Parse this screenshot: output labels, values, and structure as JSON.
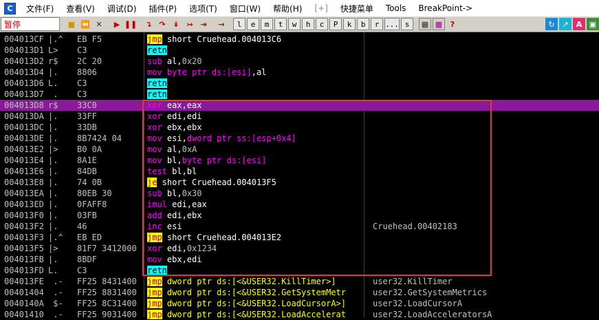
{
  "menubar": {
    "app_icon": "C",
    "items": [
      "文件(F)",
      "查看(V)",
      "调试(D)",
      "插件(P)",
      "选项(T)",
      "窗口(W)",
      "帮助(H)",
      "[+]",
      "快捷菜单",
      "Tools",
      "BreakPoint->"
    ]
  },
  "toolbar": {
    "status": "暂停",
    "letter_buttons": [
      "l",
      "e",
      "m",
      "t",
      "w",
      "h",
      "c",
      "P",
      "k",
      "b",
      "r",
      "...",
      "s"
    ]
  },
  "rows": [
    {
      "addr": "004013CF",
      "arrow": "|.^",
      "hex": "EB F5",
      "dis": [
        [
          "jmp",
          "k-jmp"
        ],
        [
          " short Cruehead.004013C6",
          "k-arg"
        ]
      ],
      "cmt": ""
    },
    {
      "addr": "004013D1",
      "arrow": "L>",
      "hex": "C3",
      "dis": [
        [
          "retn",
          "k-ret"
        ]
      ],
      "cmt": ""
    },
    {
      "addr": "004013D2",
      "arrow": "r$",
      "hex": "2C 20",
      "dis": [
        [
          "sub ",
          "k-mnem"
        ],
        [
          "al",
          "k-arg"
        ],
        [
          ",",
          "k-arg"
        ],
        [
          "0x20",
          "k-imm"
        ]
      ],
      "cmt": ""
    },
    {
      "addr": "004013D4",
      "arrow": "|.",
      "hex": "8806",
      "dis": [
        [
          "mov ",
          "k-mnem"
        ],
        [
          "byte ptr ds:[esi]",
          "k-mnem"
        ],
        [
          ",al",
          "k-arg"
        ]
      ],
      "cmt": ""
    },
    {
      "addr": "004013D6",
      "arrow": "L.",
      "hex": "C3",
      "dis": [
        [
          "retn",
          "k-ret"
        ]
      ],
      "cmt": ""
    },
    {
      "addr": "004013D7",
      "arrow": " .",
      "hex": "C3",
      "dis": [
        [
          "retn",
          "k-ret"
        ]
      ],
      "cmt": ""
    },
    {
      "addr": "004013D8",
      "arrow": "r$",
      "hex": "33C0",
      "dis": [
        [
          "xor ",
          "k-mnem"
        ],
        [
          "eax,eax",
          "k-arg"
        ]
      ],
      "cmt": "",
      "sel": true
    },
    {
      "addr": "004013DA",
      "arrow": "|.",
      "hex": "33FF",
      "dis": [
        [
          "xor ",
          "k-mnem"
        ],
        [
          "edi,edi",
          "k-arg"
        ]
      ],
      "cmt": ""
    },
    {
      "addr": "004013DC",
      "arrow": "|.",
      "hex": "33DB",
      "dis": [
        [
          "xor ",
          "k-mnem"
        ],
        [
          "ebx,ebx",
          "k-arg"
        ]
      ],
      "cmt": ""
    },
    {
      "addr": "004013DE",
      "arrow": "|.",
      "hex": "8B7424 04",
      "dis": [
        [
          "mov ",
          "k-mnem"
        ],
        [
          "esi,",
          "k-arg"
        ],
        [
          "dword ptr ss:[esp+0x4]",
          "k-mnem"
        ]
      ],
      "cmt": ""
    },
    {
      "addr": "004013E2",
      "arrow": "|>",
      "hex": "B0 0A",
      "dis": [
        [
          "mov ",
          "k-mnem"
        ],
        [
          "al,",
          "k-arg"
        ],
        [
          "0xA",
          "k-imm"
        ]
      ],
      "cmt": ""
    },
    {
      "addr": "004013E4",
      "arrow": "|.",
      "hex": "8A1E",
      "dis": [
        [
          "mov ",
          "k-mnem"
        ],
        [
          "bl,",
          "k-arg"
        ],
        [
          "byte ptr ds:[esi]",
          "k-mnem"
        ]
      ],
      "cmt": ""
    },
    {
      "addr": "004013E6",
      "arrow": "|.",
      "hex": "84DB",
      "dis": [
        [
          "test ",
          "k-mnem"
        ],
        [
          "bl,bl",
          "k-arg"
        ]
      ],
      "cmt": ""
    },
    {
      "addr": "004013E8",
      "arrow": "|.",
      "hex": "74 0B",
      "dis": [
        [
          "je",
          "k-jmp"
        ],
        [
          " short Cruehead.004013F5",
          "k-arg"
        ]
      ],
      "cmt": ""
    },
    {
      "addr": "004013EA",
      "arrow": "|.",
      "hex": "80EB 30",
      "dis": [
        [
          "sub ",
          "k-mnem"
        ],
        [
          "bl,",
          "k-arg"
        ],
        [
          "0x30",
          "k-imm"
        ]
      ],
      "cmt": ""
    },
    {
      "addr": "004013ED",
      "arrow": "|.",
      "hex": "0FAFF8",
      "dis": [
        [
          "imul ",
          "k-mnem"
        ],
        [
          "edi,eax",
          "k-arg"
        ]
      ],
      "cmt": ""
    },
    {
      "addr": "004013F0",
      "arrow": "|.",
      "hex": "03FB",
      "dis": [
        [
          "add ",
          "k-mnem"
        ],
        [
          "edi,ebx",
          "k-arg"
        ]
      ],
      "cmt": ""
    },
    {
      "addr": "004013F2",
      "arrow": "|.",
      "hex": "46",
      "dis": [
        [
          "inc ",
          "k-mnem"
        ],
        [
          "esi",
          "k-arg"
        ]
      ],
      "cmt": "Cruehead.00402183"
    },
    {
      "addr": "004013F3",
      "arrow": "|.^",
      "hex": "EB ED",
      "dis": [
        [
          "jmp",
          "k-jmp"
        ],
        [
          " short Cruehead.004013E2",
          "k-arg"
        ]
      ],
      "cmt": ""
    },
    {
      "addr": "004013F5",
      "arrow": "|>",
      "hex": "81F7 3412000",
      "dis": [
        [
          "xor ",
          "k-mnem"
        ],
        [
          "edi,",
          "k-arg"
        ],
        [
          "0x1234",
          "k-imm"
        ]
      ],
      "cmt": ""
    },
    {
      "addr": "004013FB",
      "arrow": "|.",
      "hex": "8BDF",
      "dis": [
        [
          "mov ",
          "k-mnem"
        ],
        [
          "ebx,edi",
          "k-arg"
        ]
      ],
      "cmt": ""
    },
    {
      "addr": "004013FD",
      "arrow": "L.",
      "hex": "C3",
      "dis": [
        [
          "retn",
          "k-ret"
        ]
      ],
      "cmt": ""
    },
    {
      "addr": "004013FE",
      "arrow": " .-",
      "hex": "FF25 8431400",
      "dis": [
        [
          "jmp",
          "k-jmp"
        ],
        [
          " dword ptr ds:[<&USER32.KillTimer>]",
          "k-ptr"
        ]
      ],
      "cmt": "user32.KillTimer"
    },
    {
      "addr": "00401404",
      "arrow": " .-",
      "hex": "FF25 8831400",
      "dis": [
        [
          "jmp",
          "k-jmp"
        ],
        [
          " dword ptr ds:[<&USER32.GetSystemMetr",
          "k-ptr"
        ]
      ],
      "cmt": "user32.GetSystemMetrics"
    },
    {
      "addr": "0040140A",
      "arrow": " $-",
      "hex": "FF25 8C31400",
      "dis": [
        [
          "jmp",
          "k-jmp"
        ],
        [
          " dword ptr ds:[<&USER32.LoadCursorA>]",
          "k-ptr"
        ]
      ],
      "cmt": "user32.LoadCursorA"
    },
    {
      "addr": "00401410",
      "arrow": " .-",
      "hex": "FF25 9031400",
      "dis": [
        [
          "jmp",
          "k-jmp"
        ],
        [
          " dword ptr ds:[<&USER32.LoadAccelerat",
          "k-ptr"
        ]
      ],
      "cmt": "user32.LoadAcceleratorsA"
    }
  ]
}
